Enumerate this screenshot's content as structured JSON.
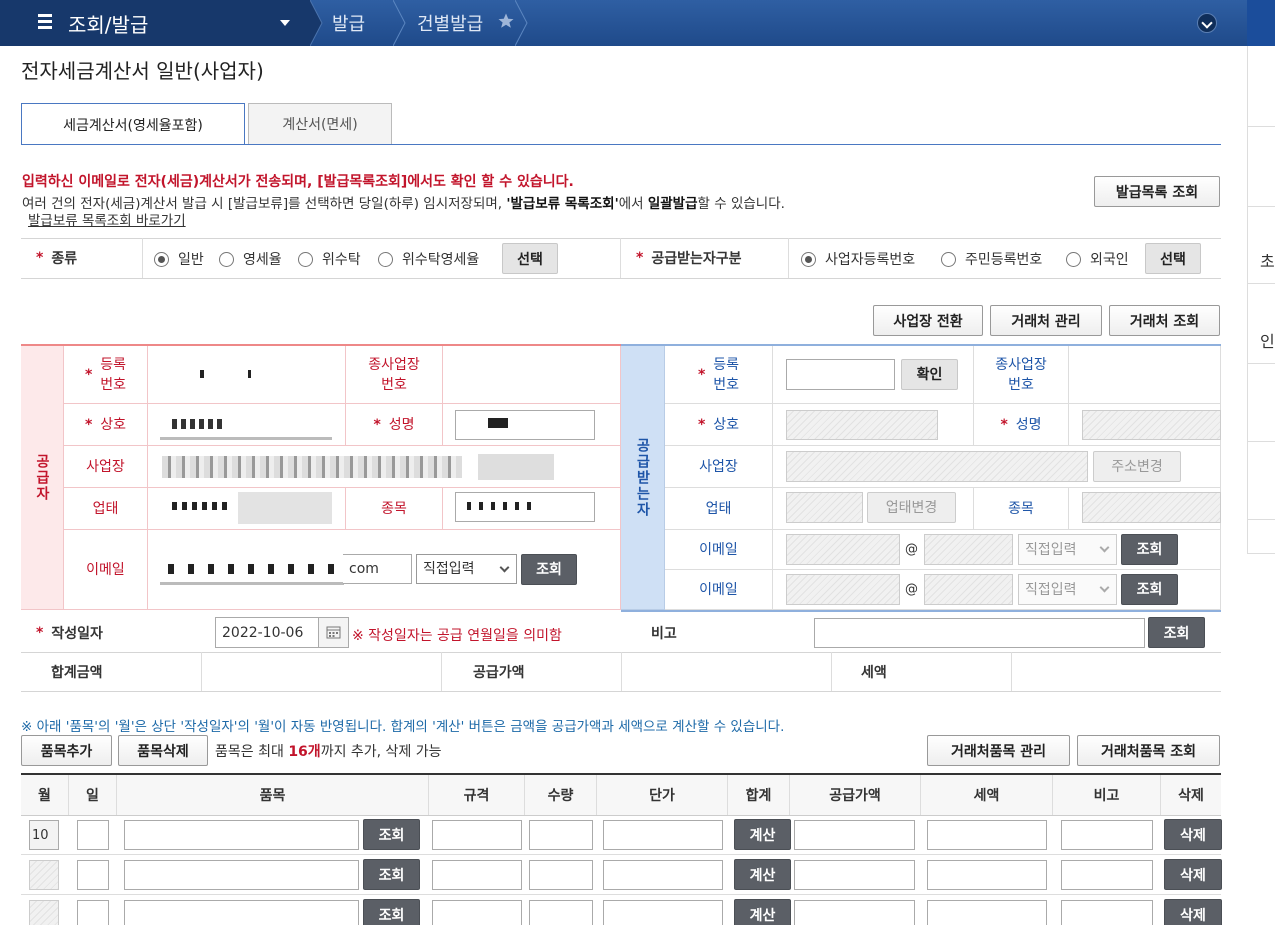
{
  "nav": {
    "menu": "조회/발급",
    "crumb1": "발급",
    "crumb2": "건별발급"
  },
  "sidepanel": {
    "char1": "초",
    "char2": "인"
  },
  "page_title": "전자세금계산서 일반(사업자)",
  "tabs": {
    "active": "세금계산서(영세율포함)",
    "inactive": "계산서(면세)"
  },
  "notice": {
    "line1": "입력하신 이메일로 전자(세금)계산서가 전송되며, [발급목록조회]에서도 확인 할 수 있습니다.",
    "line2_a": "여러 건의 전자(세금)계산서 발급 시 [발급보류]를 선택하면 당일(하루) 임시저장되며, ",
    "line2_b": "'발급보류 목록조회'",
    "line2_c": "에서 ",
    "line2_d": "일괄발급",
    "line2_e": "할 수 있습니다.",
    "link": "발급보류 목록조회 바로가기",
    "issue_list_btn": "발급목록 조회"
  },
  "kind": {
    "label": "종류",
    "options": [
      "일반",
      "영세율",
      "위수탁",
      "위수탁영세율"
    ],
    "select_btn": "선택"
  },
  "recv_type": {
    "label": "공급받는자구분",
    "options": [
      "사업자등록번호",
      "주민등록번호",
      "외국인"
    ],
    "select_btn": "선택"
  },
  "actions": {
    "switch": "사업장 전환",
    "manage": "거래처 관리",
    "lookup": "거래처 조회"
  },
  "supplier": {
    "side": "공급자",
    "reg_no": "등록\n번호",
    "sub_no": "종사업장\n번호",
    "company": "상호",
    "name": "성명",
    "address": "사업장",
    "biz_type": "업태",
    "item": "종목",
    "email": "이메일",
    "email_domain": "com",
    "email_select": "직접입력",
    "lookup_btn": "조회"
  },
  "receiver": {
    "side": "공급받는자",
    "reg_no": "등록\n번호",
    "confirm_btn": "확인",
    "sub_no": "종사업장\n번호",
    "company": "상호",
    "name": "성명",
    "address": "사업장",
    "addr_btn": "주소변경",
    "biz_type": "업태",
    "biz_btn": "업태변경",
    "item": "종목",
    "email1": "이메일",
    "email2": "이메일",
    "at": "@",
    "email_select": "직접입력",
    "lookup_btn": "조회"
  },
  "write_date": {
    "label": "작성일자",
    "value": "2022-10-06",
    "note": "※ 작성일자는 공급 연월일을 의미함",
    "memo_label": "비고",
    "lookup_btn": "조회"
  },
  "totals": {
    "total": "합계금액",
    "supply": "공급가액",
    "tax": "세액"
  },
  "item_notice": "※ 아래 '품목'의 '월'은 상단 '작성일자'의 '월'이 자동 반영됩니다. 합계의 '계산' 버튼은 금액을 공급가액과 세액으로 계산할 수 있습니다.",
  "item_buttons": {
    "add": "품목추가",
    "remove": "품목삭제",
    "limit_a": "품목은 최대 ",
    "limit_b": "16개",
    "limit_c": "까지 추가, 삭제 가능",
    "manage": "거래처품목 관리",
    "lookup": "거래처품목 조회"
  },
  "table": {
    "headers": [
      "월",
      "일",
      "품목",
      "규격",
      "수량",
      "단가",
      "합계",
      "공급가액",
      "세액",
      "비고",
      "삭제"
    ],
    "first_month": "10",
    "lookup_btn": "조회",
    "calc_btn": "계산",
    "delete_btn": "삭제"
  }
}
